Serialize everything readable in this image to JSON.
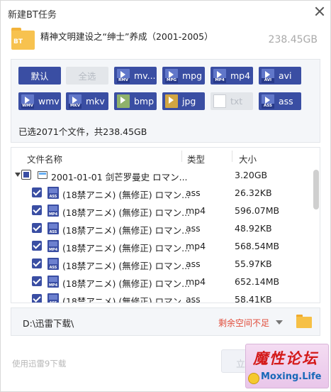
{
  "window": {
    "title": "新建BT任务"
  },
  "task": {
    "folder_badge": "BT",
    "name": "精神文明建设之“绅士”养成（2001-2005）",
    "total_size": "238.45GB"
  },
  "filters": [
    {
      "label": "默认",
      "active": true,
      "icon": ""
    },
    {
      "label": "全选",
      "active": false,
      "icon": ""
    },
    {
      "label": "mv...",
      "active": true,
      "icon": "RMV"
    },
    {
      "label": "mpg",
      "active": true,
      "icon": "MPG"
    },
    {
      "label": "mp4",
      "active": true,
      "icon": "MP4"
    },
    {
      "label": "avi",
      "active": true,
      "icon": "AVI"
    },
    {
      "label": "wmv",
      "active": true,
      "icon": "WMV"
    },
    {
      "label": "mkv",
      "active": true,
      "icon": "MKV"
    },
    {
      "label": "bmp",
      "active": true,
      "icon": ""
    },
    {
      "label": "jpg",
      "active": true,
      "icon": ""
    },
    {
      "label": "txt",
      "active": false,
      "icon": ""
    },
    {
      "label": "ass",
      "active": true,
      "icon": "ASS"
    }
  ],
  "summary": "已选2071个文件，共238.45GB",
  "file_list": {
    "columns": {
      "name": "文件名称",
      "type": "类型",
      "size": "大小"
    },
    "folder": {
      "name": "2001-01-01 剑芒罗曼史 ロマン...",
      "size": "3.20GB"
    },
    "rows": [
      {
        "name": "(18禁アニメ) (無修正) ロマン...",
        "type": "ass",
        "size": "26.32KB",
        "icon": "ASS"
      },
      {
        "name": "(18禁アニメ) (無修正) ロマン...",
        "type": "mp4",
        "size": "596.07MB",
        "icon": "MP4"
      },
      {
        "name": "(18禁アニメ) (無修正) ロマン...",
        "type": "ass",
        "size": "48.92KB",
        "icon": "ASS"
      },
      {
        "name": "(18禁アニメ) (無修正) ロマン...",
        "type": "mp4",
        "size": "568.54MB",
        "icon": "MP4"
      },
      {
        "name": "(18禁アニメ) (無修正) ロマン...",
        "type": "ass",
        "size": "55.97KB",
        "icon": "ASS"
      },
      {
        "name": "(18禁アニメ) (無修正) ロマン...",
        "type": "mp4",
        "size": "652.14MB",
        "icon": "MP4"
      },
      {
        "name": "(18禁アニメ) (無修正) ロマン...",
        "type": "ass",
        "size": "58.41KB",
        "icon": "ASS"
      }
    ]
  },
  "save_path": {
    "value": "D:\\迅雷下载\\",
    "warning": "剩余空间不足"
  },
  "footer": {
    "alt_link": "使用迅雷9下载",
    "primary_button": "立"
  },
  "watermark": {
    "title": "魔性论坛",
    "domain": "Moxing.Life"
  },
  "colors": {
    "accent": "#3a4ea3",
    "warning": "#e14c3a",
    "folder": "#f7c24f"
  }
}
